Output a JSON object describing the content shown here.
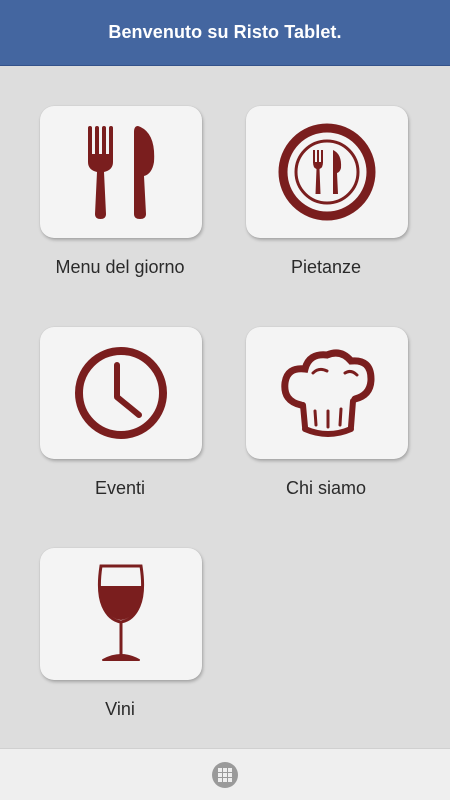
{
  "header": {
    "title": "Benvenuto su Risto Tablet."
  },
  "tiles": [
    {
      "label": "Menu del giorno",
      "icon": "cutlery-icon"
    },
    {
      "label": "Pietanze",
      "icon": "plate-cutlery-icon"
    },
    {
      "label": "Eventi",
      "icon": "clock-icon"
    },
    {
      "label": "Chi siamo",
      "icon": "chef-hat-icon"
    },
    {
      "label": "Vini",
      "icon": "wine-glass-icon"
    }
  ],
  "footer": {
    "icon": "grid-menu-icon"
  },
  "colors": {
    "header": "#4466a0",
    "icon": "#7a1e1e",
    "background": "#dddddd",
    "card": "#f4f4f4"
  }
}
